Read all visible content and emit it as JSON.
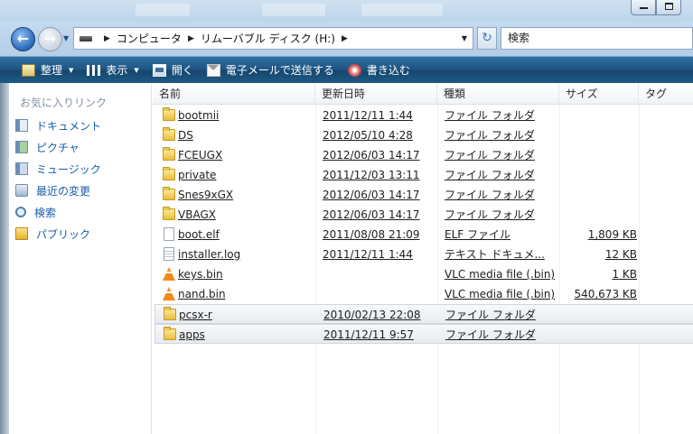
{
  "window": {
    "minimize_glyph": "—",
    "maximize_glyph": "▢"
  },
  "navigation": {
    "back_glyph": "←",
    "forward_glyph": "→",
    "breadcrumbs": [
      "コンピュータ",
      "リムーバブル ディスク (H:)"
    ],
    "search_label": "検索",
    "refresh_glyph": "↻"
  },
  "toolbar": {
    "organize": "整理",
    "views": "表示",
    "open": "開く",
    "email": "電子メールで送信する",
    "burn": "書き込む"
  },
  "sidebar": {
    "title": "お気に入りリンク",
    "items": [
      {
        "label": "ドキュメント",
        "icon": "documents-icon"
      },
      {
        "label": "ピクチャ",
        "icon": "pictures-icon"
      },
      {
        "label": "ミュージック",
        "icon": "music-icon"
      },
      {
        "label": "最近の変更",
        "icon": "recent-changes-icon"
      },
      {
        "label": "検索",
        "icon": "search-folder-icon"
      },
      {
        "label": "パブリック",
        "icon": "public-folder-icon"
      }
    ]
  },
  "columns": [
    "名前",
    "更新日時",
    "種類",
    "サイズ",
    "タグ"
  ],
  "files": [
    {
      "name": "bootmii",
      "date": "2011/12/11 1:44",
      "type": "ファイル フォルダ",
      "size": "",
      "icon": "folder"
    },
    {
      "name": "DS",
      "date": "2012/05/10 4:28",
      "type": "ファイル フォルダ",
      "size": "",
      "icon": "folder"
    },
    {
      "name": "FCEUGX",
      "date": "2012/06/03 14:17",
      "type": "ファイル フォルダ",
      "size": "",
      "icon": "folder"
    },
    {
      "name": "private",
      "date": "2011/12/03 13:11",
      "type": "ファイル フォルダ",
      "size": "",
      "icon": "folder"
    },
    {
      "name": "Snes9xGX",
      "date": "2012/06/03 14:17",
      "type": "ファイル フォルダ",
      "size": "",
      "icon": "folder"
    },
    {
      "name": "VBAGX",
      "date": "2012/06/03 14:17",
      "type": "ファイル フォルダ",
      "size": "",
      "icon": "folder"
    },
    {
      "name": "boot.elf",
      "date": "2011/08/08 21:09",
      "type": "ELF ファイル",
      "size": "1,809 KB",
      "icon": "file"
    },
    {
      "name": "installer.log",
      "date": "2011/12/11 1:44",
      "type": "テキスト ドキュメ...",
      "size": "12 KB",
      "icon": "log"
    },
    {
      "name": "keys.bin",
      "date": "",
      "type": "VLC media file (.bin)",
      "size": "1 KB",
      "icon": "vlc"
    },
    {
      "name": "nand.bin",
      "date": "",
      "type": "VLC media file (.bin)",
      "size": "540,673 KB",
      "icon": "vlc"
    },
    {
      "name": "pcsx-r",
      "date": "2010/02/13 22:08",
      "type": "ファイル フォルダ",
      "size": "",
      "icon": "folder",
      "selected": true
    },
    {
      "name": "apps",
      "date": "2011/12/11 9:57",
      "type": "ファイル フォルダ",
      "size": "",
      "icon": "folder",
      "selected": true
    }
  ],
  "colors": {
    "toolbar_bg": "#1f5583",
    "link_blue": "#1a5ca8",
    "folder_yellow": "#e9bf3c",
    "vlc_orange": "#f28a1a"
  }
}
